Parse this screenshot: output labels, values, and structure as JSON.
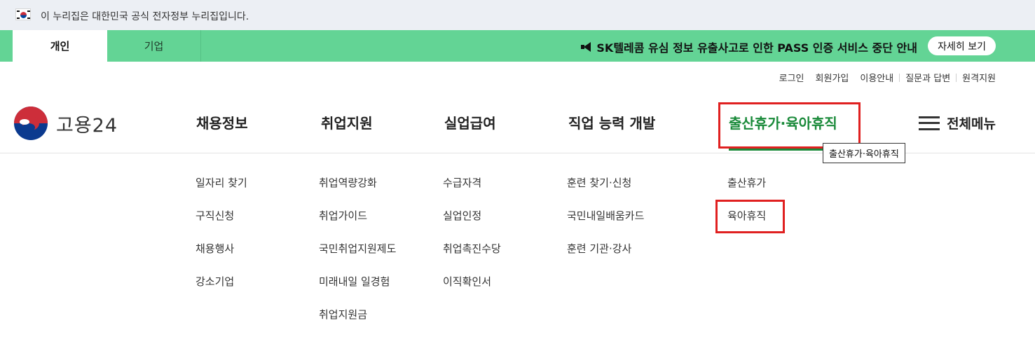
{
  "gov_banner": {
    "text": "이 누리집은 대한민국 공식 전자정부 누리집입니다."
  },
  "tabs": [
    {
      "label": "개인"
    },
    {
      "label": "기업"
    }
  ],
  "notice": {
    "text": "SK텔레콤 유심 정보 유출사고로 인한 PASS 인증 서비스 중단 안내",
    "button": "자세히 보기"
  },
  "utility_links": [
    {
      "label": "로그인"
    },
    {
      "label": "회원가입"
    },
    {
      "label": "이용안내"
    },
    {
      "label": "질문과 답변"
    },
    {
      "label": "원격지원"
    }
  ],
  "logo": {
    "text": "고용24"
  },
  "nav": [
    {
      "label": "채용정보"
    },
    {
      "label": "취업지원"
    },
    {
      "label": "실업급여"
    },
    {
      "label": "직업 능력 개발"
    },
    {
      "label": "출산휴가·육아휴직"
    }
  ],
  "all_menu": {
    "label": "전체메뉴"
  },
  "tooltip": {
    "text": "출산휴가·육아휴직"
  },
  "submenus": [
    {
      "items": [
        "일자리 찾기",
        "구직신청",
        "채용행사",
        "강소기업"
      ]
    },
    {
      "items": [
        "취업역량강화",
        "취업가이드",
        "국민취업지원제도",
        "미래내일 일경험",
        "취업지원금"
      ]
    },
    {
      "items": [
        "수급자격",
        "실업인정",
        "취업촉진수당",
        "이직확인서"
      ]
    },
    {
      "items": [
        "훈련 찾기·신청",
        "국민내일배움카드",
        "훈련 기관·강사"
      ]
    },
    {
      "items": [
        "출산휴가",
        "육아휴직"
      ]
    }
  ],
  "colors": {
    "green_bar": "#63d495",
    "active_nav": "#1a8a3a",
    "highlight": "#e02020",
    "gov_banner": "#eceff4"
  }
}
